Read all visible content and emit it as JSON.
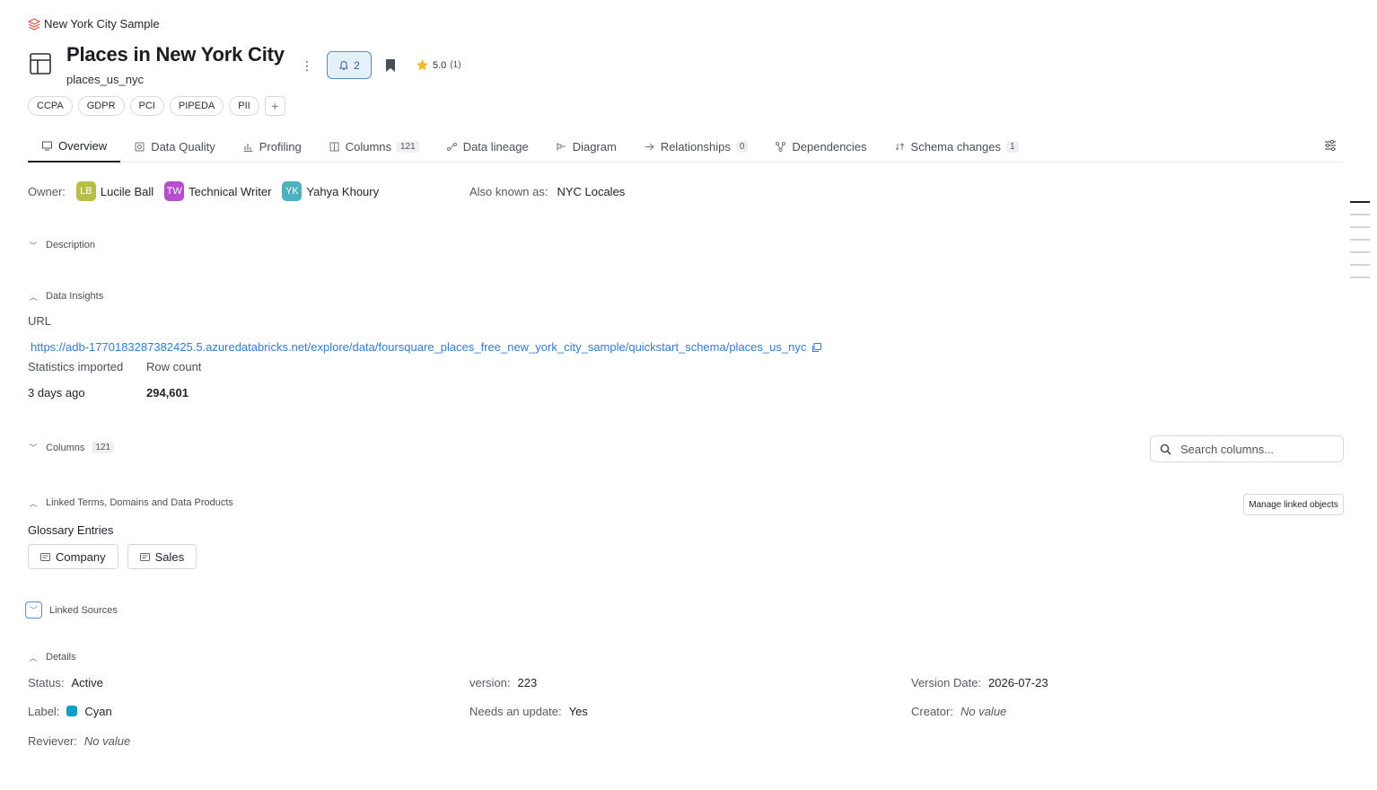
{
  "breadcrumb": {
    "source": "New York City Sample"
  },
  "header": {
    "title": "Places in New York City",
    "subtitle": "places_us_nyc",
    "notifications": "2",
    "rating": "5.0",
    "rating_count": "(1)"
  },
  "tags": [
    "CCPA",
    "GDPR",
    "PCI",
    "PIPEDA",
    "PII"
  ],
  "tag_add": "+",
  "tabs": [
    {
      "label": "Overview",
      "icon": "overview-icon"
    },
    {
      "label": "Data Quality",
      "icon": "data-quality-icon"
    },
    {
      "label": "Profiling",
      "icon": "profiling-icon"
    },
    {
      "label": "Columns",
      "count": "121",
      "icon": "columns-icon"
    },
    {
      "label": "Data lineage",
      "icon": "lineage-icon"
    },
    {
      "label": "Diagram",
      "icon": "diagram-icon"
    },
    {
      "label": "Relationships",
      "count": "0",
      "icon": "relationships-icon"
    },
    {
      "label": "Dependencies",
      "icon": "dependencies-icon"
    },
    {
      "label": "Schema changes",
      "count": "1",
      "icon": "schema-changes-icon"
    }
  ],
  "owner": {
    "label": "Owner:",
    "people": [
      {
        "initials": "LB",
        "name": "Lucile Ball",
        "color": "#b5bf4a"
      },
      {
        "initials": "TW",
        "name": "Technical Writer",
        "color": "#b54fc9"
      },
      {
        "initials": "YK",
        "name": "Yahya Khoury",
        "color": "#4fb0bf"
      }
    ]
  },
  "aka": {
    "label": "Also known as:",
    "value": "NYC Locales"
  },
  "sections": {
    "description": "Description",
    "insights": "Data Insights",
    "columns": "Columns",
    "columns_count": "121",
    "linked": "Linked Terms, Domains and Data Products",
    "linked_sources": "Linked Sources",
    "details": "Details"
  },
  "insights": {
    "url_label": "URL",
    "url": "https://adb-1770183287382425.5.azuredatabricks.net/explore/data/foursquare_places_free_new_york_city_sample/quickstart_schema/places_us_nyc",
    "stats_label": "Statistics imported",
    "stats_value": "3 days ago",
    "rows_label": "Row count",
    "rows_value": "294,601"
  },
  "search": {
    "placeholder": "Search columns..."
  },
  "manage_button": "Manage linked objects",
  "glossary": {
    "title": "Glossary Entries",
    "items": [
      "Company",
      "Sales"
    ]
  },
  "details": {
    "status_label": "Status:",
    "status_value": "Active",
    "version_label": "version:",
    "version_value": "223",
    "vdate_label": "Version Date:",
    "vdate_value": "2026-07-23",
    "label_label": "Label:",
    "label_value": "Cyan",
    "label_color": "#0ea0c8",
    "needs_label": "Needs an update:",
    "needs_value": "Yes",
    "creator_label": "Creator:",
    "creator_value": "No value",
    "reviewer_label": "Reviever:",
    "reviewer_value": "No value"
  }
}
